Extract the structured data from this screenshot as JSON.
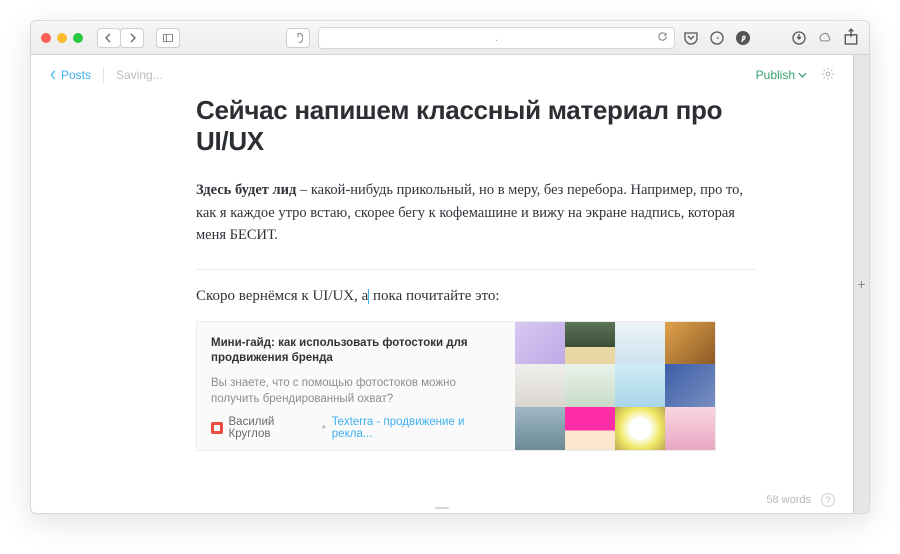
{
  "browser": {
    "url_display": "."
  },
  "appbar": {
    "back_label": "Posts",
    "status": "Saving...",
    "publish_label": "Publish"
  },
  "doc": {
    "title": "Сейчас напишем классный материал про UI/UX",
    "lead_strong": "Здесь будет лид",
    "lead_rest": " – какой-нибудь прикольный, но в меру, без перебора. Например, про то, как я каждое утро встаю, скорее бегу к кофемашине и вижу на экране надпись, которая меня БЕСИТ.",
    "body_before": "Скоро вернёмся к UI/UX, а",
    "body_after": " пока почитайте это:"
  },
  "card": {
    "title": "Мини-гайд: как использовать фотостоки для продвижения бренда",
    "desc": "Вы знаете, что с помощью фотостоков можно получить брендированный охват?",
    "author": "Василий Круглов",
    "sep": "•",
    "source": "Texterra - продвижение и рекла..."
  },
  "footer": {
    "word_count": "58 words",
    "help": "?"
  }
}
